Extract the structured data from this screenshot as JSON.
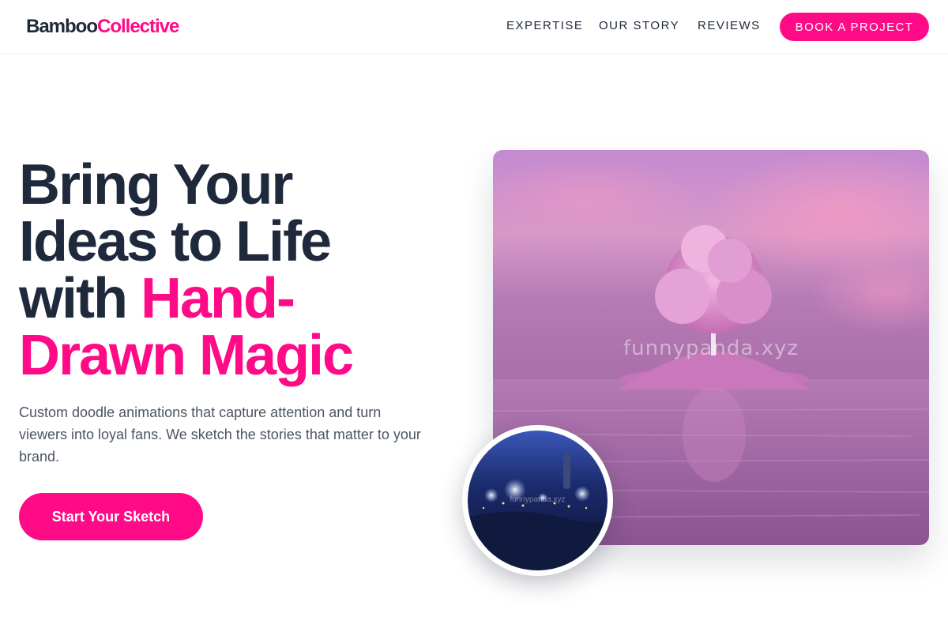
{
  "brand": {
    "part1": "Bamboo",
    "part2": "Collective"
  },
  "nav": {
    "links": [
      "EXPERTISE",
      "OUR STORY",
      "REVIEWS"
    ],
    "cta": "BOOK A PROJECT"
  },
  "hero": {
    "headline_line1": "Bring Your",
    "headline_line2": "Ideas to Life",
    "headline_line3_plain": "with ",
    "headline_line3_accent": "Hand-",
    "headline_line4_accent": "Drawn Magic",
    "subcopy": "Custom doodle animations that capture attention and turn viewers into loyal fans. We sketch the stories that matter to your brand.",
    "cta": "Start Your Sketch"
  },
  "images": {
    "main_watermark": "funnypanda.xyz",
    "circle_watermark": "funnypanda.xyz"
  },
  "colors": {
    "accent": "#ff0a87",
    "heading": "#1e293b",
    "body": "#4b5563"
  }
}
